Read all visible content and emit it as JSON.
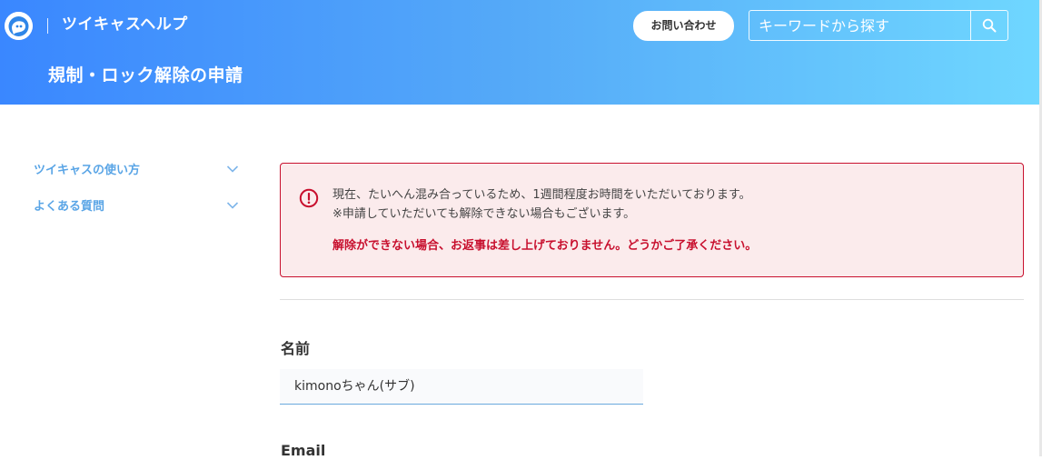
{
  "header": {
    "site_title": "ツイキャスヘルプ",
    "contact_label": "お問い合わせ",
    "search": {
      "placeholder": "キーワードから探す"
    },
    "page_title": "規制・ロック解除の申請"
  },
  "sidebar": {
    "items": [
      {
        "label": "ツイキャスの使い方"
      },
      {
        "label": "よくある質問"
      }
    ]
  },
  "notice": {
    "line1": "現在、たいへん混み合っているため、1週間程度お時間をいただいております。",
    "line2": "※申請していただいても解除できない場合もございます。",
    "warning": "解除ができない場合、お返事は差し上げておりません。どうかご了承ください。"
  },
  "form": {
    "name_label": "名前",
    "name_value": "kimonoちゃん(サブ)",
    "email_label": "Email"
  },
  "colors": {
    "header_gradient_start": "#3a87ff",
    "header_gradient_end": "#6fd7ff",
    "sidebar_link": "#5aa5e6",
    "alert_red": "#c8102e",
    "alert_background": "#fbebec"
  }
}
